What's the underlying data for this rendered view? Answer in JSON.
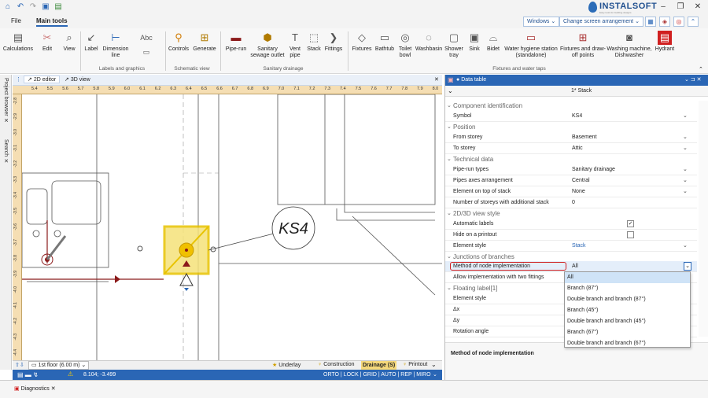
{
  "app": {
    "brand": "INSTALSOFT",
    "brand_sub": "Easy tools for building designs",
    "accent": "#2a66b5"
  },
  "menu": {
    "file": "File",
    "main_tools": "Main tools",
    "windows": "Windows",
    "screen_arr": "Change screen arrangement"
  },
  "ribbon": {
    "buttons": [
      {
        "label": "Calculations",
        "icon": "calc-icon"
      },
      {
        "label": "Edit",
        "icon": "edit-icon"
      },
      {
        "label": "View",
        "icon": "view-icon"
      },
      {
        "label": "Label",
        "icon": "label-icon"
      },
      {
        "label": "Dimension line",
        "icon": "dimension-icon"
      },
      {
        "label": "Controls",
        "icon": "controls-icon"
      },
      {
        "label": "Generate",
        "icon": "generate-icon"
      },
      {
        "label": "Pipe-run",
        "icon": "pipe-icon"
      },
      {
        "label": "Sanitary sewage outlet",
        "icon": "sewage-icon"
      },
      {
        "label": "Vent pipe",
        "icon": "vent-icon"
      },
      {
        "label": "Stack",
        "icon": "stack-icon"
      },
      {
        "label": "Fittings",
        "icon": "fittings-icon"
      },
      {
        "label": "Fixtures",
        "icon": "fixtures-icon"
      },
      {
        "label": "Bathtub",
        "icon": "bathtub-icon"
      },
      {
        "label": "Toilet bowl",
        "icon": "toilet-icon"
      },
      {
        "label": "Washbasin",
        "icon": "washbasin-icon"
      },
      {
        "label": "Shower tray",
        "icon": "shower-icon"
      },
      {
        "label": "Sink",
        "icon": "sink-icon"
      },
      {
        "label": "Bidet",
        "icon": "bidet-icon"
      },
      {
        "label": "Water hygiene station (standalone)",
        "icon": "hygiene-icon"
      },
      {
        "label": "Fixtures and draw-off points",
        "icon": "drawoff-icon"
      },
      {
        "label": "Washing machine, Dishwasher",
        "icon": "washer-icon"
      },
      {
        "label": "Hydrant",
        "icon": "hydrant-icon"
      }
    ],
    "groups": [
      "Labels and graphics",
      "Schematic view",
      "Sanitary drainage",
      "Fixtures and water taps"
    ]
  },
  "side": {
    "project_browser": "Project browser",
    "search": "Search"
  },
  "editor": {
    "tab2d": "2D editor",
    "tab3d": "3D view",
    "ruler_x": [
      "5.4",
      "5.5",
      "5.6",
      "5.7",
      "5.8",
      "5.9",
      "6.0",
      "6.1",
      "6.2",
      "6.3",
      "6.4",
      "6.5",
      "6.6",
      "6.7",
      "6.8",
      "6.9",
      "7.0",
      "7.1",
      "7.2",
      "7.3",
      "7.4",
      "7.5",
      "7.6",
      "7.7",
      "7.8",
      "7.9",
      "8.0"
    ],
    "ruler_y": [
      "-2.8",
      "-2.9",
      "-3.0",
      "-3.1",
      "-3.2",
      "-3.3",
      "-3.4",
      "-3.5",
      "-3.6",
      "-3.7",
      "-3.8",
      "-3.9",
      "-4.0",
      "-4.1",
      "-4.2",
      "-4.3",
      "-4.4"
    ],
    "stack_label": "KS4"
  },
  "status": {
    "floor": "1st floor (6.00 m)",
    "underlay": "Underlay",
    "construction": "Construction",
    "drainage": "Drainage (S)",
    "printout": "Printout",
    "coords": "8.104; -3.499",
    "modes": "ORTO | LOCK | GRID | AUTO | REP | MIRO"
  },
  "bottom": {
    "diagnostics": "Diagnostics"
  },
  "datatable": {
    "title": "Data table",
    "object": "1* Stack",
    "sections": [
      "Component identification",
      "Position",
      "Technical data",
      "2D/3D view style",
      "Junctions of branches",
      "Floating label[1]"
    ],
    "rows": [
      {
        "label": "Symbol",
        "value": "KS4"
      },
      {
        "label": "From storey",
        "value": "Basement"
      },
      {
        "label": "To storey",
        "value": "Attic"
      },
      {
        "label": "Pipe-run types",
        "value": "Sanitary drainage"
      },
      {
        "label": "Pipes axes arrangement",
        "value": "Central"
      },
      {
        "label": "Element on top of stack",
        "value": "None"
      },
      {
        "label": "Number of storeys with additional stack",
        "value": "0"
      },
      {
        "label": "Automatic labels",
        "value": ""
      },
      {
        "label": "Hide on a printout",
        "value": ""
      },
      {
        "label": "Element style",
        "value": "Stack"
      },
      {
        "label": "Method of node implementation",
        "value": "All"
      },
      {
        "label": "Allow implementation with two fittings",
        "value": ""
      },
      {
        "label": "Element style",
        "value": ""
      },
      {
        "label": "Δx",
        "value": ""
      },
      {
        "label": "Δy",
        "value": ""
      },
      {
        "label": "Rotation angle",
        "value": ""
      }
    ],
    "dropdown_options": [
      "All",
      "Branch (87°)",
      "Double branch and branch (87°)",
      "Branch (45°)",
      "Double branch and branch (45°)",
      "Branch (67°)",
      "Double branch and branch (67°)"
    ],
    "description": "Method of node implementation"
  }
}
